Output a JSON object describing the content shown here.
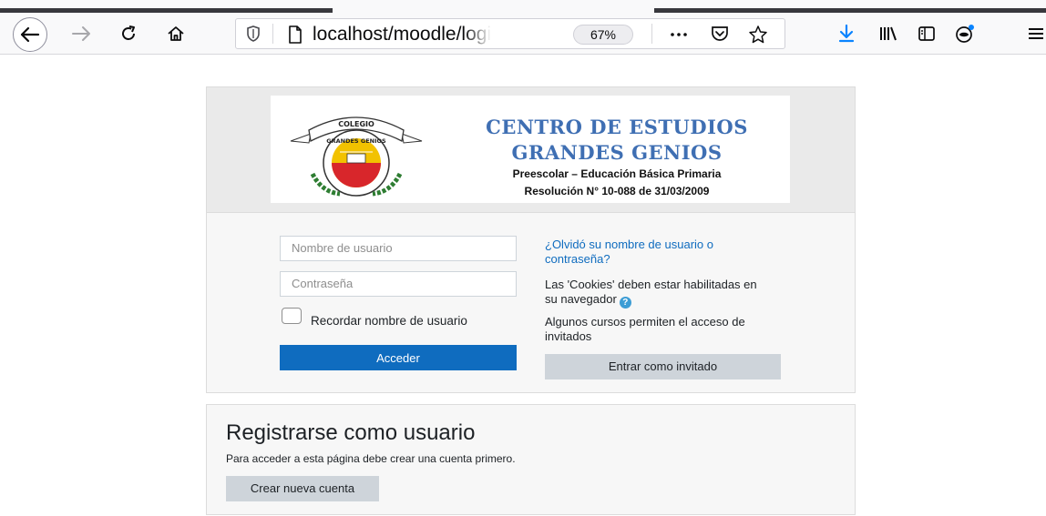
{
  "browser": {
    "url": "localhost/moodle/login/",
    "zoom": "67%",
    "icons": [
      "back-arrow-icon",
      "forward-arrow-icon",
      "reload-icon",
      "home-icon",
      "shield-icon",
      "page-icon",
      "more-icon",
      "pocket-icon",
      "bookmark-star-icon",
      "download-icon",
      "library-icon",
      "sidebar-icon",
      "account-icon",
      "menu-icon"
    ]
  },
  "logo": {
    "emblem_text": "COLEGIO",
    "emblem_ribbon": "GRANDES GENIOS",
    "title_line1": "CENTRO DE ESTUDIOS",
    "title_line2": "GRANDES GENIOS",
    "subtitle": "Preescolar – Educación Básica Primaria",
    "resolution": "Resolución N° 10-088 de 31/03/2009",
    "colors": {
      "title": "#3f6fb3",
      "emblem_red": "#d8262b",
      "emblem_yellow": "#f2c200",
      "emblem_green": "#2e7d32"
    }
  },
  "login": {
    "username_placeholder": "Nombre de usuario",
    "password_placeholder": "Contraseña",
    "remember_label": "Recordar nombre de usuario",
    "submit_label": "Acceder",
    "forgot_link": "¿Olvidó su nombre de usuario o contraseña?",
    "cookies_notice": "Las 'Cookies' deben estar habilitadas en su navegador",
    "guest_notice": "Algunos cursos permiten el acceso de invitados",
    "guest_button": "Entrar como invitado",
    "accent_color": "#0f6cbf"
  },
  "register": {
    "title": "Registrarse como usuario",
    "text": "Para acceder a esta página debe crear una cuenta primero.",
    "button": "Crear nueva cuenta"
  }
}
